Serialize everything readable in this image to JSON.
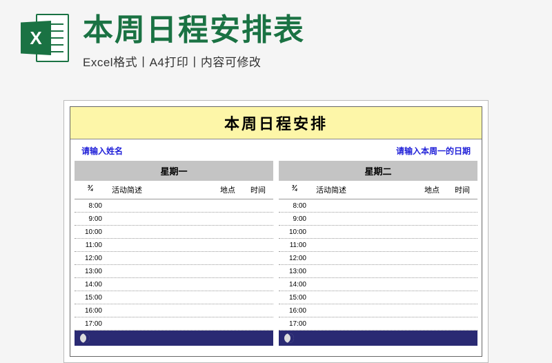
{
  "header": {
    "icon_letter": "X",
    "main_title": "本周日程安排表",
    "subtitle": "Excel格式丨A4打印丨内容可修改"
  },
  "sheet": {
    "title": "本周日程安排",
    "name_placeholder": "请输入姓名",
    "date_placeholder": "请输入本周一的日期",
    "columns": {
      "date_fraction_1": "¾",
      "date_fraction_2": "¾",
      "activity": "活动简述",
      "place": "地点",
      "time": "时间"
    },
    "days": [
      {
        "label": "星期一"
      },
      {
        "label": "星期二"
      }
    ],
    "times": [
      "8:00",
      "9:00",
      "10:00",
      "11:00",
      "12:00",
      "13:00",
      "14:00",
      "15:00",
      "16:00",
      "17:00"
    ]
  }
}
